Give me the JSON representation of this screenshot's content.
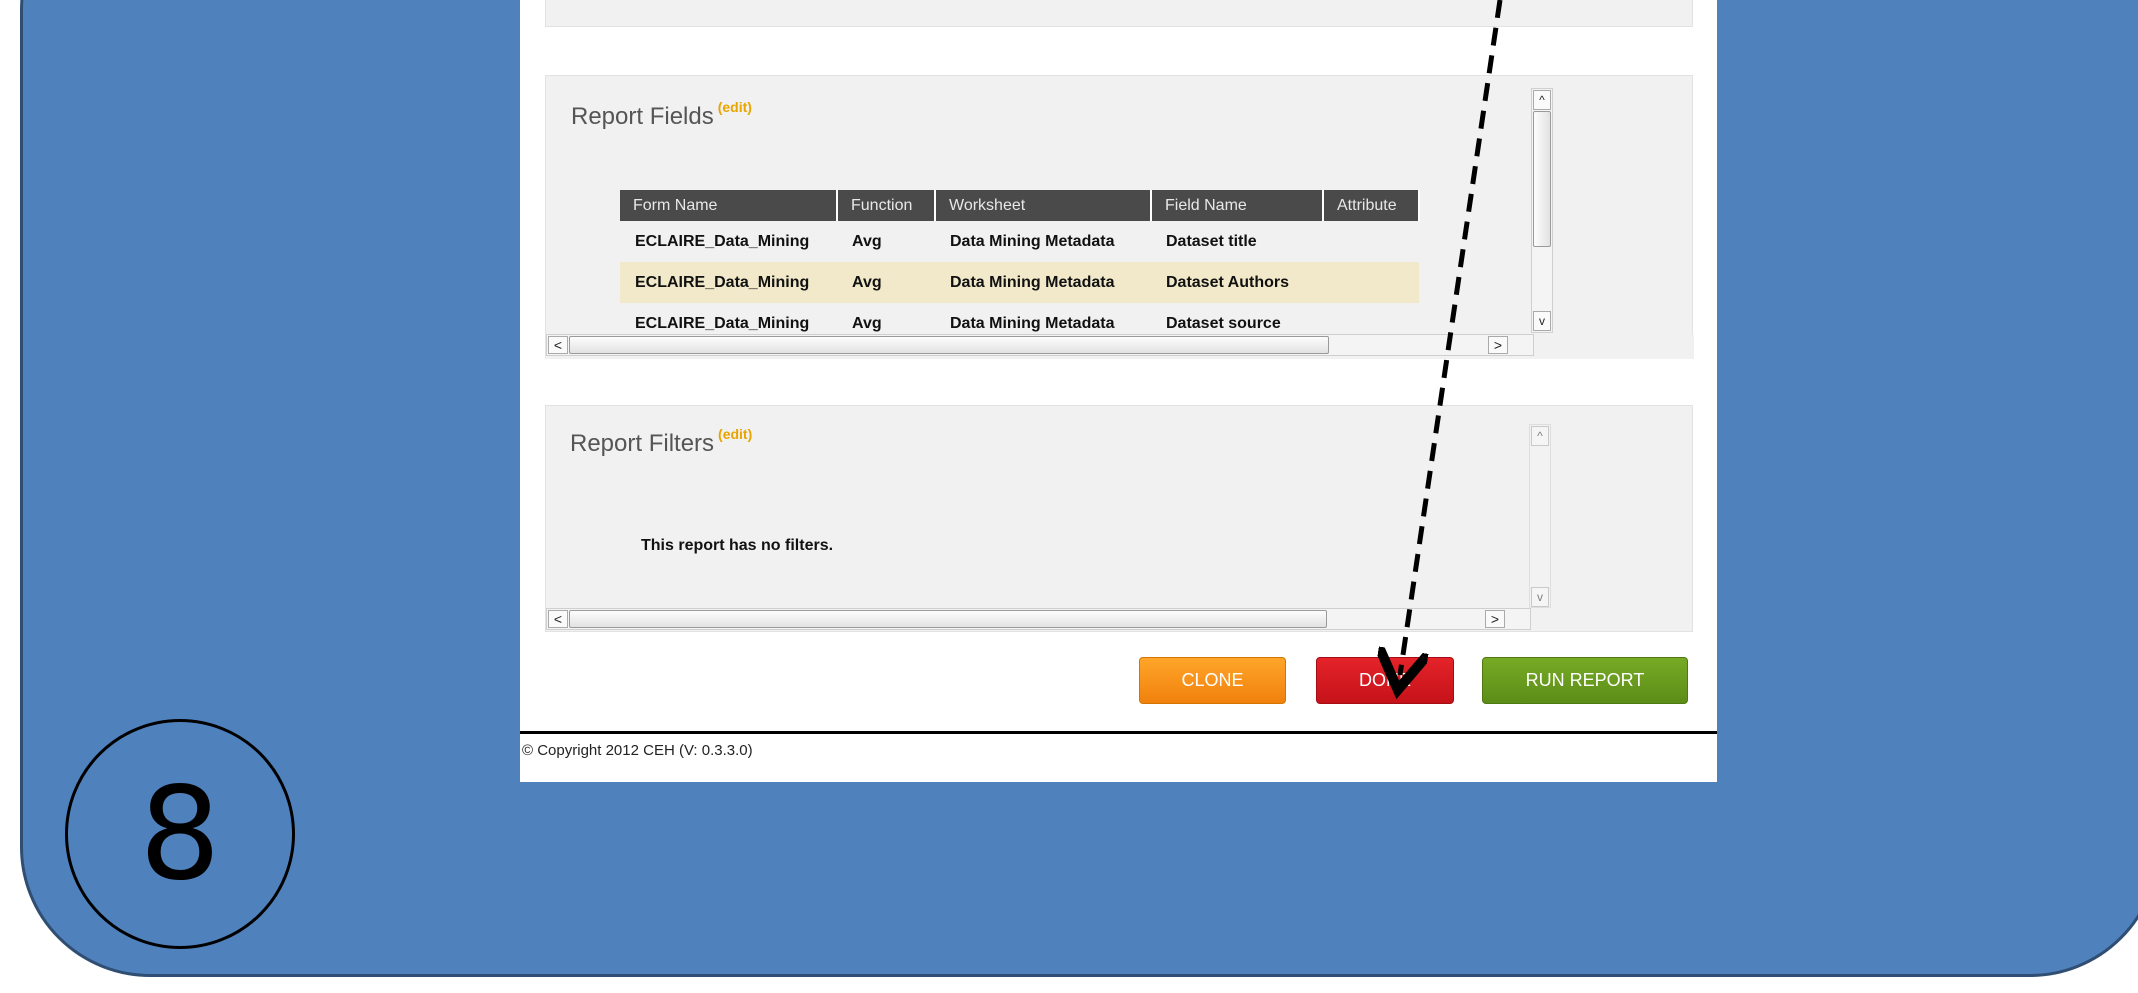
{
  "step_number": "8",
  "report_fields": {
    "title": "Report Fields",
    "edit_label": "(edit)",
    "columns": [
      "Form Name",
      "Function",
      "Worksheet",
      "Field Name",
      "Attribute"
    ],
    "rows": [
      [
        "ECLAIRE_Data_Mining",
        "Avg",
        "Data Mining Metadata",
        "Dataset title",
        ""
      ],
      [
        "ECLAIRE_Data_Mining",
        "Avg",
        "Data Mining Metadata",
        "Dataset Authors",
        ""
      ],
      [
        "ECLAIRE_Data_Mining",
        "Avg",
        "Data Mining Metadata",
        "Dataset source",
        ""
      ]
    ]
  },
  "report_filters": {
    "title": "Report Filters",
    "edit_label": "(edit)",
    "empty_message": "This report has no filters."
  },
  "buttons": {
    "clone": "CLONE",
    "done": "DONE",
    "run_report": "RUN REPORT"
  },
  "footer": {
    "copyright": "© Copyright 2012 CEH  (V: 0.3.3.0)"
  },
  "scroll_glyphs": {
    "left": "<",
    "right": ">",
    "up": "^",
    "down": "v",
    "grip": "III"
  },
  "colors": {
    "slide_background": "#4f81bd",
    "clone_button": "#f59218",
    "done_button": "#d61b22",
    "run_report_button": "#6a9c1f",
    "edit_link": "#e8a400",
    "table_header": "#4a4a4a",
    "highlight_row": "#f1e9c9"
  }
}
